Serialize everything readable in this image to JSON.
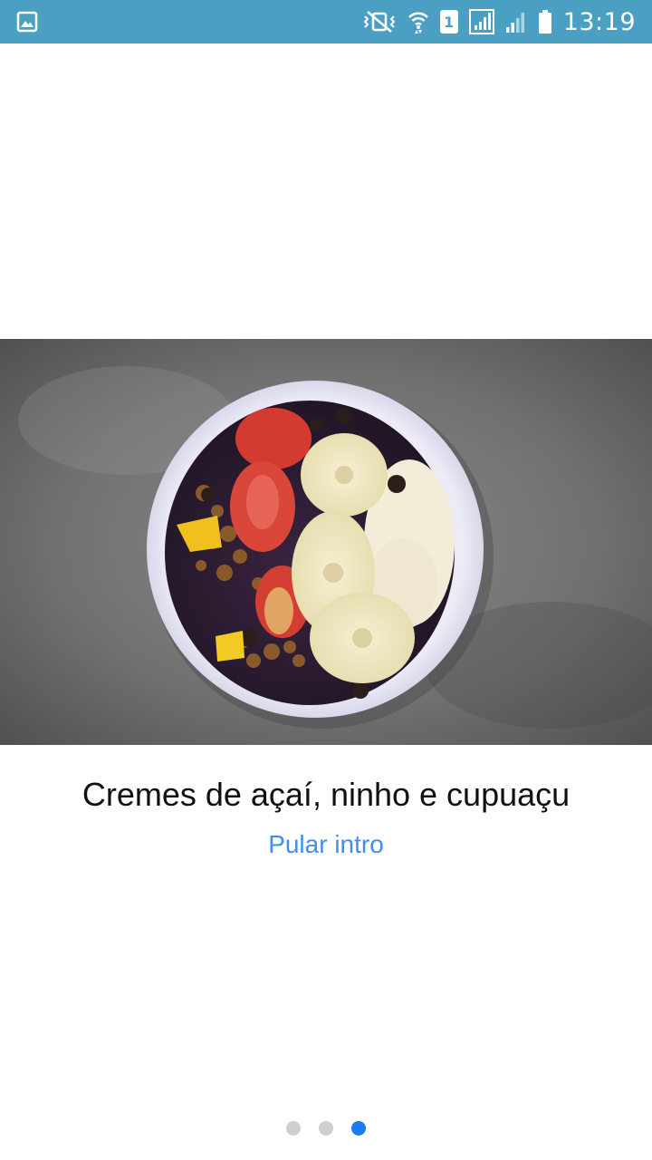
{
  "status_bar": {
    "time": "13:19",
    "sim_label": "1",
    "icons": [
      "gallery-icon",
      "vibrate-icon",
      "wifi-icon",
      "sim-icon",
      "signal-icon",
      "signal-weak-icon",
      "battery-icon"
    ]
  },
  "slide": {
    "image": "acai-bowl-photo",
    "title": "Cremes de açaí, ninho e cupuaçu",
    "skip_label": "Pular intro"
  },
  "pager": {
    "total": 3,
    "active_index": 2
  },
  "colors": {
    "status_bar": "#4a9fc3",
    "link": "#3f8ef0",
    "dot_active": "#1a7cf0",
    "dot_inactive": "#cfcfcf"
  }
}
